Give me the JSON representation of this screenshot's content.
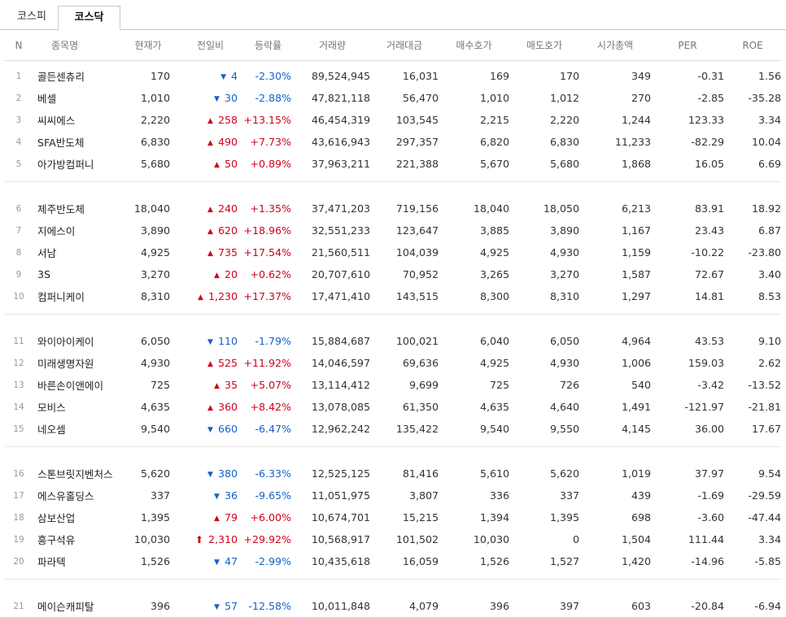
{
  "tabs": [
    {
      "label": "코스피",
      "active": false
    },
    {
      "label": "코스닥",
      "active": true
    }
  ],
  "columns": {
    "n": "N",
    "name": "종목명",
    "price": "현재가",
    "change": "전일비",
    "rate": "등락률",
    "volume": "거래량",
    "amount": "거래대금",
    "bid": "매수호가",
    "ask": "매도호가",
    "market_cap": "시가총액",
    "per": "PER",
    "roe": "ROE"
  },
  "colors": {
    "up": "#d0021b",
    "down": "#1560c7"
  },
  "groups": [
    [
      {
        "n": "1",
        "name": "골든센츄리",
        "price": "170",
        "dir": "down",
        "change": "4",
        "rate": "-2.30%",
        "volume": "89,524,945",
        "amount": "16,031",
        "bid": "169",
        "ask": "170",
        "cap": "349",
        "per": "-0.31",
        "roe": "1.56"
      },
      {
        "n": "2",
        "name": "베셀",
        "price": "1,010",
        "dir": "down",
        "change": "30",
        "rate": "-2.88%",
        "volume": "47,821,118",
        "amount": "56,470",
        "bid": "1,010",
        "ask": "1,012",
        "cap": "270",
        "per": "-2.85",
        "roe": "-35.28"
      },
      {
        "n": "3",
        "name": "씨씨에스",
        "price": "2,220",
        "dir": "up",
        "change": "258",
        "rate": "+13.15%",
        "volume": "46,454,319",
        "amount": "103,545",
        "bid": "2,215",
        "ask": "2,220",
        "cap": "1,244",
        "per": "123.33",
        "roe": "3.34"
      },
      {
        "n": "4",
        "name": "SFA반도체",
        "price": "6,830",
        "dir": "up",
        "change": "490",
        "rate": "+7.73%",
        "volume": "43,616,943",
        "amount": "297,357",
        "bid": "6,820",
        "ask": "6,830",
        "cap": "11,233",
        "per": "-82.29",
        "roe": "10.04"
      },
      {
        "n": "5",
        "name": "아가방컴퍼니",
        "price": "5,680",
        "dir": "up",
        "change": "50",
        "rate": "+0.89%",
        "volume": "37,963,211",
        "amount": "221,388",
        "bid": "5,670",
        "ask": "5,680",
        "cap": "1,868",
        "per": "16.05",
        "roe": "6.69"
      }
    ],
    [
      {
        "n": "6",
        "name": "제주반도체",
        "price": "18,040",
        "dir": "up",
        "change": "240",
        "rate": "+1.35%",
        "volume": "37,471,203",
        "amount": "719,156",
        "bid": "18,040",
        "ask": "18,050",
        "cap": "6,213",
        "per": "83.91",
        "roe": "18.92"
      },
      {
        "n": "7",
        "name": "지에스이",
        "price": "3,890",
        "dir": "up",
        "change": "620",
        "rate": "+18.96%",
        "volume": "32,551,233",
        "amount": "123,647",
        "bid": "3,885",
        "ask": "3,890",
        "cap": "1,167",
        "per": "23.43",
        "roe": "6.87"
      },
      {
        "n": "8",
        "name": "서남",
        "price": "4,925",
        "dir": "up",
        "change": "735",
        "rate": "+17.54%",
        "volume": "21,560,511",
        "amount": "104,039",
        "bid": "4,925",
        "ask": "4,930",
        "cap": "1,159",
        "per": "-10.22",
        "roe": "-23.80"
      },
      {
        "n": "9",
        "name": "3S",
        "price": "3,270",
        "dir": "up",
        "change": "20",
        "rate": "+0.62%",
        "volume": "20,707,610",
        "amount": "70,952",
        "bid": "3,265",
        "ask": "3,270",
        "cap": "1,587",
        "per": "72.67",
        "roe": "3.40"
      },
      {
        "n": "10",
        "name": "컴퍼니케이",
        "price": "8,310",
        "dir": "up",
        "change": "1,230",
        "rate": "+17.37%",
        "volume": "17,471,410",
        "amount": "143,515",
        "bid": "8,300",
        "ask": "8,310",
        "cap": "1,297",
        "per": "14.81",
        "roe": "8.53"
      }
    ],
    [
      {
        "n": "11",
        "name": "와이아이케이",
        "price": "6,050",
        "dir": "down",
        "change": "110",
        "rate": "-1.79%",
        "volume": "15,884,687",
        "amount": "100,021",
        "bid": "6,040",
        "ask": "6,050",
        "cap": "4,964",
        "per": "43.53",
        "roe": "9.10"
      },
      {
        "n": "12",
        "name": "미래생명자원",
        "price": "4,930",
        "dir": "up",
        "change": "525",
        "rate": "+11.92%",
        "volume": "14,046,597",
        "amount": "69,636",
        "bid": "4,925",
        "ask": "4,930",
        "cap": "1,006",
        "per": "159.03",
        "roe": "2.62"
      },
      {
        "n": "13",
        "name": "바른손이앤에이",
        "price": "725",
        "dir": "up",
        "change": "35",
        "rate": "+5.07%",
        "volume": "13,114,412",
        "amount": "9,699",
        "bid": "725",
        "ask": "726",
        "cap": "540",
        "per": "-3.42",
        "roe": "-13.52"
      },
      {
        "n": "14",
        "name": "모비스",
        "price": "4,635",
        "dir": "up",
        "change": "360",
        "rate": "+8.42%",
        "volume": "13,078,085",
        "amount": "61,350",
        "bid": "4,635",
        "ask": "4,640",
        "cap": "1,491",
        "per": "-121.97",
        "roe": "-21.81"
      },
      {
        "n": "15",
        "name": "네오셈",
        "price": "9,540",
        "dir": "down",
        "change": "660",
        "rate": "-6.47%",
        "volume": "12,962,242",
        "amount": "135,422",
        "bid": "9,540",
        "ask": "9,550",
        "cap": "4,145",
        "per": "36.00",
        "roe": "17.67"
      }
    ],
    [
      {
        "n": "16",
        "name": "스톤브릿지벤처스",
        "price": "5,620",
        "dir": "down",
        "change": "380",
        "rate": "-6.33%",
        "volume": "12,525,125",
        "amount": "81,416",
        "bid": "5,610",
        "ask": "5,620",
        "cap": "1,019",
        "per": "37.97",
        "roe": "9.54"
      },
      {
        "n": "17",
        "name": "에스유홀딩스",
        "price": "337",
        "dir": "down",
        "change": "36",
        "rate": "-9.65%",
        "volume": "11,051,975",
        "amount": "3,807",
        "bid": "336",
        "ask": "337",
        "cap": "439",
        "per": "-1.69",
        "roe": "-29.59"
      },
      {
        "n": "18",
        "name": "삼보산업",
        "price": "1,395",
        "dir": "up",
        "change": "79",
        "rate": "+6.00%",
        "volume": "10,674,701",
        "amount": "15,215",
        "bid": "1,394",
        "ask": "1,395",
        "cap": "698",
        "per": "-3.60",
        "roe": "-47.44"
      },
      {
        "n": "19",
        "name": "흥구석유",
        "price": "10,030",
        "dir": "upper",
        "change": "2,310",
        "rate": "+29.92%",
        "volume": "10,568,917",
        "amount": "101,502",
        "bid": "10,030",
        "ask": "0",
        "cap": "1,504",
        "per": "111.44",
        "roe": "3.34"
      },
      {
        "n": "20",
        "name": "파라텍",
        "price": "1,526",
        "dir": "down",
        "change": "47",
        "rate": "-2.99%",
        "volume": "10,435,618",
        "amount": "16,059",
        "bid": "1,526",
        "ask": "1,527",
        "cap": "1,420",
        "per": "-14.96",
        "roe": "-5.85"
      }
    ],
    [
      {
        "n": "21",
        "name": "메이슨캐피탈",
        "price": "396",
        "dir": "down",
        "change": "57",
        "rate": "-12.58%",
        "volume": "10,011,848",
        "amount": "4,079",
        "bid": "396",
        "ask": "397",
        "cap": "603",
        "per": "-20.84",
        "roe": "-6.94"
      }
    ]
  ]
}
